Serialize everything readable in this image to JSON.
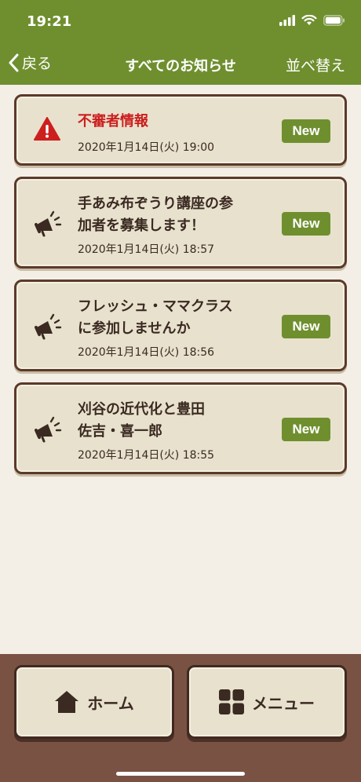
{
  "status_bar": {
    "time": "19:21"
  },
  "nav": {
    "back_label": "戻る",
    "title": "すべてのお知らせ",
    "sort_label": "並べ替え"
  },
  "notices": [
    {
      "icon": "warning-icon",
      "title_lines": [
        "不審者情報"
      ],
      "date": "2020年1月14日(火) 19:00",
      "badge": "New",
      "alert": true
    },
    {
      "icon": "megaphone-icon",
      "title_lines": [
        "手あみ布ぞうり講座の参",
        "加者を募集します！"
      ],
      "date": "2020年1月14日(火) 18:57",
      "badge": "New",
      "alert": false
    },
    {
      "icon": "megaphone-icon",
      "title_lines": [
        "フレッシュ・ママクラス",
        "に参加しませんか"
      ],
      "date": "2020年1月14日(火) 18:56",
      "badge": "New",
      "alert": false
    },
    {
      "icon": "megaphone-icon",
      "title_lines": [
        "刈谷の近代化と豊田",
        "佐吉・喜一郎"
      ],
      "date": "2020年1月14日(火) 18:55",
      "badge": "New",
      "alert": false
    }
  ],
  "bottom": {
    "home_label": "ホーム",
    "menu_label": "メニュー"
  },
  "colors": {
    "header": "#6f8f2f",
    "badge": "#6f8f2f",
    "alert_text": "#cc1f1f",
    "card_border": "#5a3a2a",
    "bottom_bar": "#7a5243"
  }
}
